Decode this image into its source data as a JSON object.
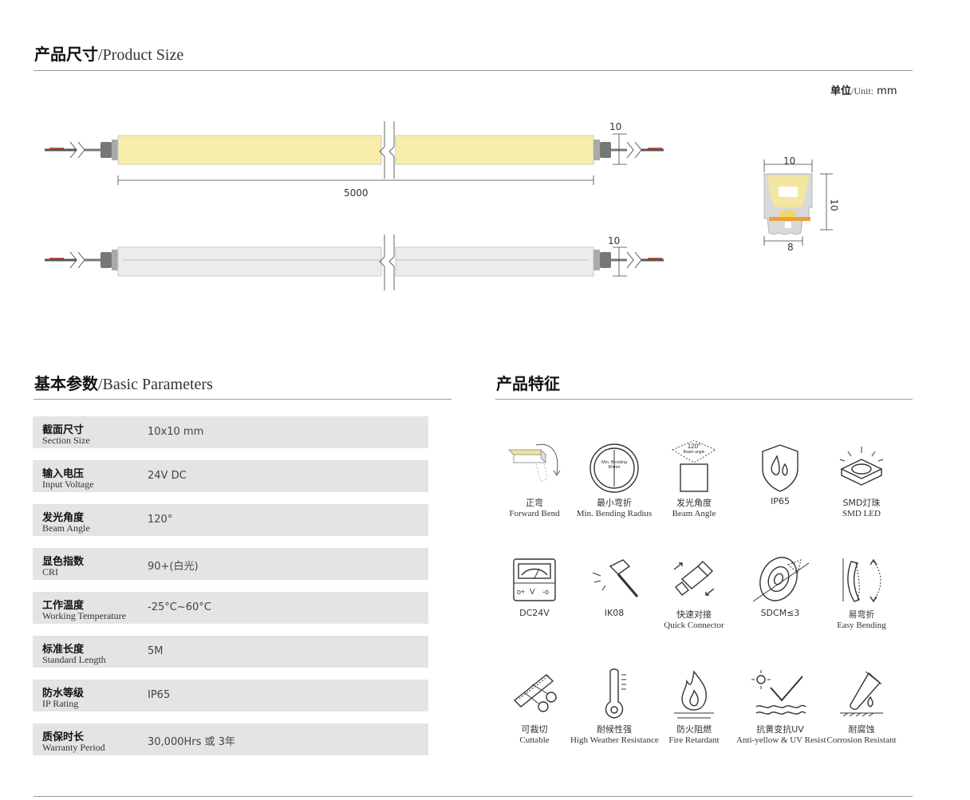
{
  "product_size": {
    "title_zh": "产品尺寸",
    "title_en": "/Product Size",
    "unit_zh": "单位",
    "unit_en": "/Unit:",
    "unit_value": "mm",
    "dim_height_top": "10",
    "dim_length": "5000",
    "dim_height_bottom": "10",
    "section_width_top": "10",
    "section_height": "10",
    "section_width_bottom": "8"
  },
  "basic_params": {
    "title_zh": "基本参数",
    "title_en": "/Basic Parameters",
    "rows": [
      {
        "zh": "截面尺寸",
        "en": "Section Size",
        "value": "10x10 mm"
      },
      {
        "zh": "输入电压",
        "en": "Input Voltage",
        "value": "24V DC"
      },
      {
        "zh": "发光角度",
        "en": "Beam Angle",
        "value": "120°"
      },
      {
        "zh": "显色指数",
        "en": "CRI",
        "value": "90+(白光)"
      },
      {
        "zh": "工作温度",
        "en": "Working Temperature",
        "value": "-25°C~60°C"
      },
      {
        "zh": "标准长度",
        "en": "Standard Length",
        "value": "5M"
      },
      {
        "zh": "防水等级",
        "en": "IP Rating",
        "value": "IP65"
      },
      {
        "zh": "质保时长",
        "en": "Warranty Period",
        "value": "30,000Hrs 或 3年"
      }
    ]
  },
  "features": {
    "title_zh": "产品特征",
    "items": [
      {
        "icon": "forward-bend-icon",
        "zh": "正弯",
        "en": "Forward Bend"
      },
      {
        "icon": "bending-radius-icon",
        "zh": "最小弯折",
        "en": "Min. Bending Radius",
        "inner_line1": "Min. Bending",
        "inner_line2": "80mm"
      },
      {
        "icon": "beam-angle-icon",
        "zh": "发光角度",
        "en": "Beam Angle",
        "inner_line1": "120°",
        "inner_line2": "Beam angle"
      },
      {
        "icon": "water-drop-shield-icon",
        "zh": "IP65",
        "en": ""
      },
      {
        "icon": "smd-led-icon",
        "zh": "SMD灯珠",
        "en": "SMD LED"
      },
      {
        "icon": "voltmeter-icon",
        "zh": "DC24V",
        "en": ""
      },
      {
        "icon": "hammer-icon",
        "zh": "IK08",
        "en": ""
      },
      {
        "icon": "quick-connector-icon",
        "zh": "快速对接",
        "en": "Quick Connector"
      },
      {
        "icon": "color-tolerance-icon",
        "zh": "SDCM≤3",
        "en": ""
      },
      {
        "icon": "easy-bending-icon",
        "zh": "易弯折",
        "en": "Easy Bending"
      },
      {
        "icon": "scissors-icon",
        "zh": "可裁切",
        "en": "Cuttable"
      },
      {
        "icon": "thermometer-icon",
        "zh": "耐候性强",
        "en": "High Weather Resistance"
      },
      {
        "icon": "flame-icon",
        "zh": "防火阻燃",
        "en": "Fire Retardant"
      },
      {
        "icon": "sun-check-icon",
        "zh": "抗黄变抗UV",
        "en": "Anti-yellow & UV Resist"
      },
      {
        "icon": "test-tube-icon",
        "zh": "耐腐蚀",
        "en": "Corrosion Resistant"
      }
    ]
  },
  "colors": {
    "strip_lit": "#f8eeaa",
    "strip_unlit": "#ececec",
    "row_bg": "#e4e4e4",
    "rule": "#9a9a9a",
    "led_orange": "#e8a23c"
  }
}
